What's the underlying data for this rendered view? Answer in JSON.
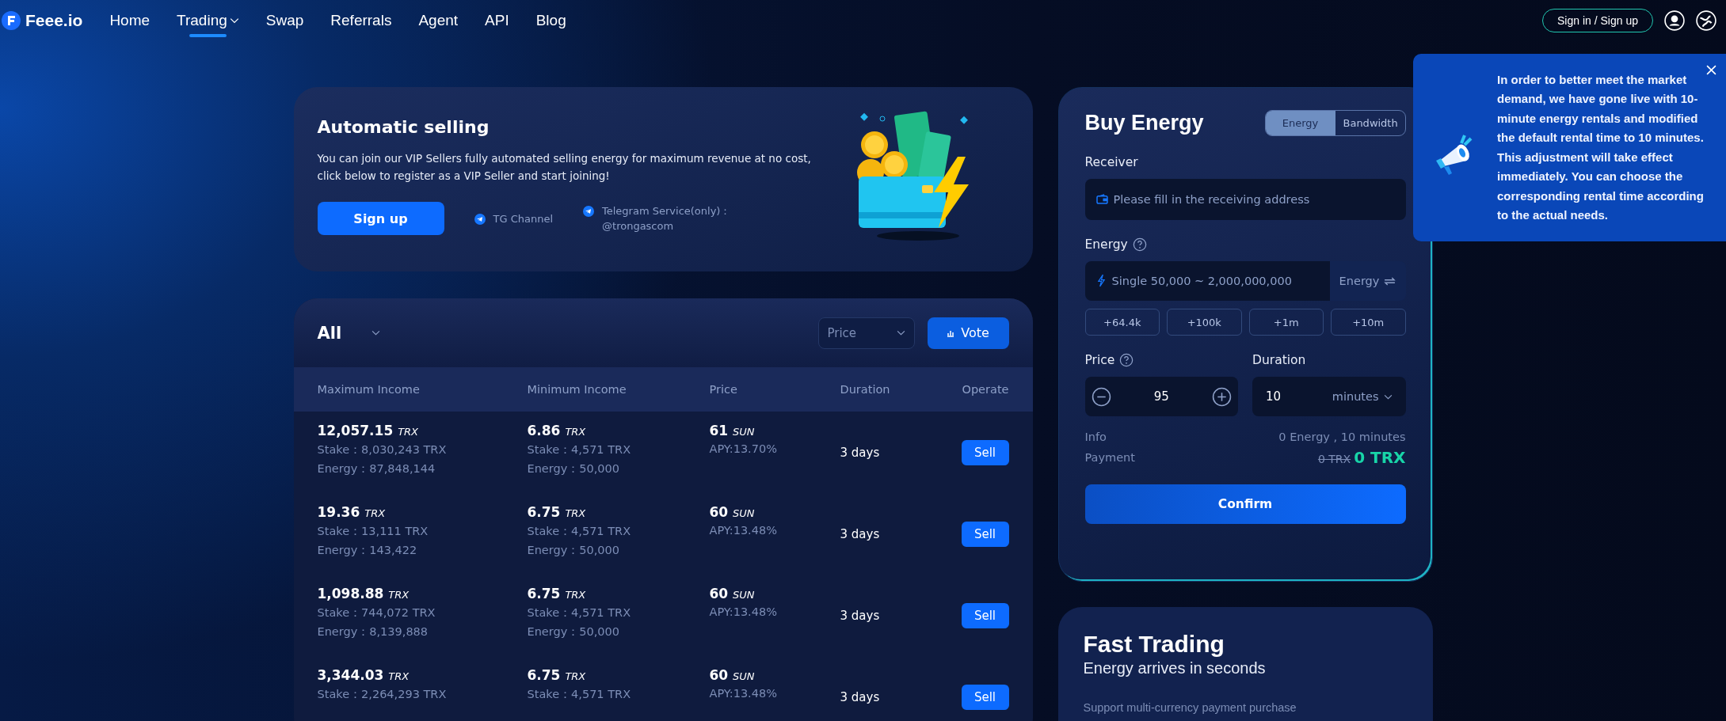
{
  "nav": {
    "logo": "Feee.io",
    "items": [
      {
        "label": "Home",
        "selected": false,
        "dropdown": false
      },
      {
        "label": "Trading",
        "selected": true,
        "dropdown": true
      },
      {
        "label": "Swap",
        "selected": false,
        "dropdown": false
      },
      {
        "label": "Referrals",
        "selected": false,
        "dropdown": false
      },
      {
        "label": "Agent",
        "selected": false,
        "dropdown": false
      },
      {
        "label": "API",
        "selected": false,
        "dropdown": false
      },
      {
        "label": "Blog",
        "selected": false,
        "dropdown": false
      }
    ],
    "sign_in": "Sign in / Sign up"
  },
  "auto_selling": {
    "title": "Automatic selling",
    "text": "You can join our VIP Sellers fully automated selling energy for maximum revenue at no cost, click below to register as a VIP Seller and start joining!",
    "button": "Sign up",
    "links": [
      "TG Channel",
      "Telegram Service(only)：\n@trongascom"
    ]
  },
  "market": {
    "filter": "All",
    "sort_placeholder": "Price",
    "vote": "Vote",
    "columns": [
      "Maximum Income",
      "Minimum Income",
      "Price",
      "Duration",
      "Operate"
    ],
    "rows": [
      {
        "max": {
          "amount": "12,057.15",
          "unit": "TRX",
          "lines": [
            "Stake：8,030,243 TRX",
            "Energy：87,848,144"
          ]
        },
        "min": {
          "amount": "6.86",
          "unit": "TRX",
          "lines": [
            "Stake：4,571 TRX",
            "Energy：50,000"
          ]
        },
        "price": {
          "amount": "61",
          "unit": "SUN",
          "lines": [
            "APY:13.70%"
          ]
        },
        "duration": "3 days",
        "action": "Sell"
      },
      {
        "max": {
          "amount": "19.36",
          "unit": "TRX",
          "lines": [
            "Stake：13,111 TRX",
            "Energy：143,422"
          ]
        },
        "min": {
          "amount": "6.75",
          "unit": "TRX",
          "lines": [
            "Stake：4,571 TRX",
            "Energy：50,000"
          ]
        },
        "price": {
          "amount": "60",
          "unit": "SUN",
          "lines": [
            "APY:13.48%"
          ]
        },
        "duration": "3 days",
        "action": "Sell"
      },
      {
        "max": {
          "amount": "1,098.88",
          "unit": "TRX",
          "lines": [
            "Stake：744,072 TRX",
            "Energy：8,139,888"
          ]
        },
        "min": {
          "amount": "6.75",
          "unit": "TRX",
          "lines": [
            "Stake：4,571 TRX",
            "Energy：50,000"
          ]
        },
        "price": {
          "amount": "60",
          "unit": "SUN",
          "lines": [
            "APY:13.48%"
          ]
        },
        "duration": "3 days",
        "action": "Sell"
      },
      {
        "max": {
          "amount": "3,344.03",
          "unit": "TRX",
          "lines": [
            "Stake：2,264,293 TRX"
          ]
        },
        "min": {
          "amount": "6.75",
          "unit": "TRX",
          "lines": [
            "Stake：4,571 TRX"
          ]
        },
        "price": {
          "amount": "60",
          "unit": "SUN",
          "lines": [
            "APY:13.48%"
          ]
        },
        "duration": "3 days",
        "action": "Sell"
      }
    ]
  },
  "buy_energy": {
    "title": "Buy Energy",
    "tabs": [
      {
        "label": "Energy",
        "selected": true
      },
      {
        "label": "Bandwidth",
        "selected": false
      }
    ],
    "receiver_label": "Receiver",
    "receiver_placeholder": "Please fill in the receiving address",
    "energy_label": "Energy",
    "energy_placeholder": "Single 50,000 ~ 2,000,000,000",
    "energy_unit": "Energy",
    "quick_amounts": [
      "+64.4k",
      "+100k",
      "+1m",
      "+10m"
    ],
    "price_label": "Price",
    "price_value": "95",
    "duration_label": "Duration",
    "duration_value": "10",
    "duration_unit": "minutes",
    "info_label": "Info",
    "info_value": "0 Energy , 10 minutes",
    "payment_label": "Payment",
    "payment_old": "0 TRX",
    "payment_new": "0 TRX",
    "confirm": "Confirm"
  },
  "notice": {
    "text": "In order to better meet the market demand, we have gone live with 10-minute energy rentals and modified the default rental time to 10 minutes. This adjustment will take effect immediately. You can choose the corresponding rental time according to the actual needs."
  },
  "fast_trading": {
    "title": "Fast Trading",
    "subtitle": "Energy arrives in seconds",
    "text": "Support multi-currency payment purchase"
  }
}
